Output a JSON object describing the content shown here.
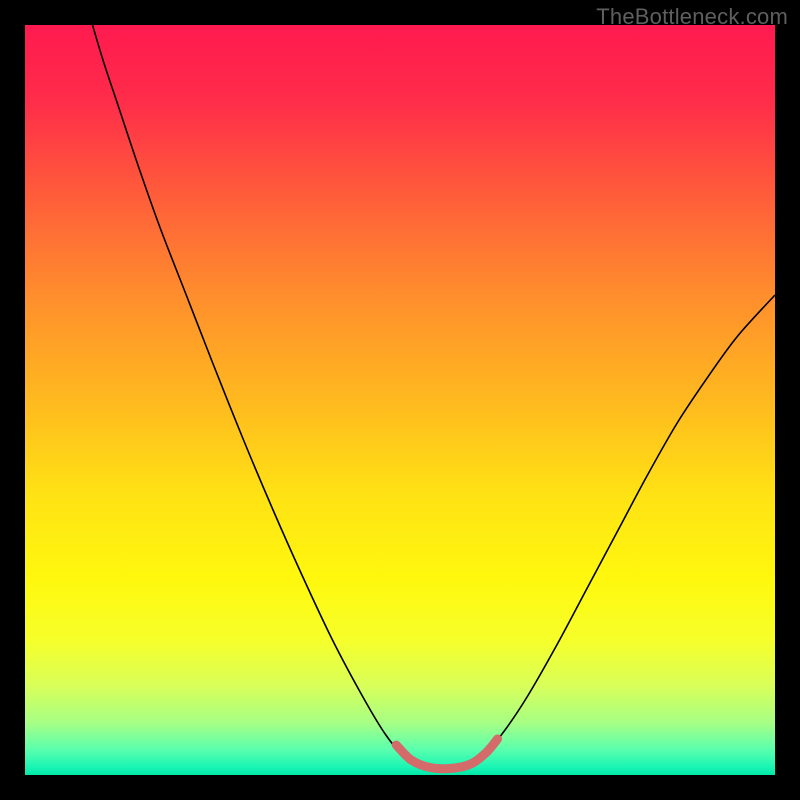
{
  "watermark": "TheBottleneck.com",
  "chart_data": {
    "type": "line",
    "title": "",
    "xlabel": "",
    "ylabel": "",
    "xlim": [
      0,
      100
    ],
    "ylim": [
      0,
      100
    ],
    "gradient_stops": [
      {
        "offset": 0.0,
        "color": "#ff1a4f"
      },
      {
        "offset": 0.1,
        "color": "#ff2c4a"
      },
      {
        "offset": 0.22,
        "color": "#ff5a3b"
      },
      {
        "offset": 0.35,
        "color": "#ff8a2e"
      },
      {
        "offset": 0.5,
        "color": "#ffb91f"
      },
      {
        "offset": 0.63,
        "color": "#ffe314"
      },
      {
        "offset": 0.74,
        "color": "#fff80e"
      },
      {
        "offset": 0.82,
        "color": "#f6ff2a"
      },
      {
        "offset": 0.88,
        "color": "#d9ff58"
      },
      {
        "offset": 0.93,
        "color": "#a7ff84"
      },
      {
        "offset": 0.965,
        "color": "#5dffad"
      },
      {
        "offset": 0.99,
        "color": "#18f5b5"
      },
      {
        "offset": 1.0,
        "color": "#00e7a8"
      }
    ],
    "series": [
      {
        "name": "bottleneck-curve",
        "color": "#000000",
        "width": 1.6,
        "points": [
          {
            "x": 9.0,
            "y": 100.0
          },
          {
            "x": 10.5,
            "y": 95.0
          },
          {
            "x": 12.5,
            "y": 89.0
          },
          {
            "x": 15.0,
            "y": 81.5
          },
          {
            "x": 18.0,
            "y": 73.0
          },
          {
            "x": 21.5,
            "y": 64.0
          },
          {
            "x": 25.0,
            "y": 55.0
          },
          {
            "x": 29.0,
            "y": 45.0
          },
          {
            "x": 33.0,
            "y": 35.5
          },
          {
            "x": 37.0,
            "y": 26.5
          },
          {
            "x": 41.0,
            "y": 18.0
          },
          {
            "x": 45.0,
            "y": 10.5
          },
          {
            "x": 48.0,
            "y": 5.5
          },
          {
            "x": 50.5,
            "y": 2.5
          },
          {
            "x": 53.0,
            "y": 1.0
          },
          {
            "x": 56.0,
            "y": 0.6
          },
          {
            "x": 59.0,
            "y": 1.2
          },
          {
            "x": 61.5,
            "y": 3.0
          },
          {
            "x": 64.0,
            "y": 6.0
          },
          {
            "x": 67.0,
            "y": 10.5
          },
          {
            "x": 71.0,
            "y": 17.5
          },
          {
            "x": 75.0,
            "y": 25.0
          },
          {
            "x": 79.0,
            "y": 32.5
          },
          {
            "x": 83.0,
            "y": 40.0
          },
          {
            "x": 87.0,
            "y": 47.0
          },
          {
            "x": 91.0,
            "y": 53.0
          },
          {
            "x": 95.0,
            "y": 58.5
          },
          {
            "x": 100.0,
            "y": 64.0
          }
        ]
      },
      {
        "name": "valley-overlay",
        "color": "#d46a6a",
        "width": 9,
        "cap": "round",
        "points": [
          {
            "x": 49.5,
            "y": 4.0
          },
          {
            "x": 51.5,
            "y": 2.0
          },
          {
            "x": 54.0,
            "y": 1.0
          },
          {
            "x": 57.0,
            "y": 0.9
          },
          {
            "x": 59.5,
            "y": 1.5
          },
          {
            "x": 61.5,
            "y": 3.0
          },
          {
            "x": 63.0,
            "y": 4.8
          }
        ]
      }
    ]
  }
}
